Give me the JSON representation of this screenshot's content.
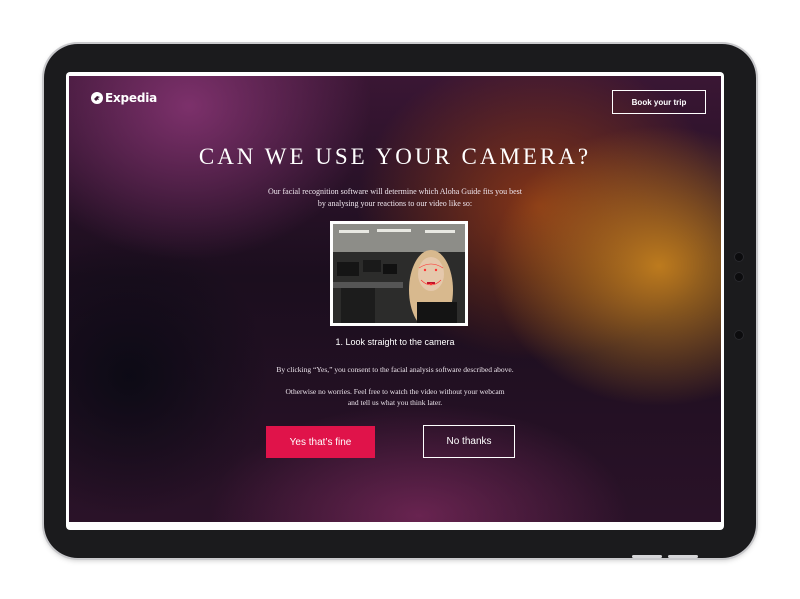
{
  "brand": {
    "name": "Expedia",
    "logo_icon": "plane-globe-icon"
  },
  "header": {
    "cta_label": "Book your trip"
  },
  "main": {
    "title": "CAN WE USE YOUR CAMERA?",
    "subtitle_line1": "Our facial recognition software will determine which Aloha Guide fits you best",
    "subtitle_line2": "by analysing your reactions to our video like so:",
    "step_caption": "1. Look straight to the camera",
    "consent_text": "By clicking “Yes,” you consent to the facial analysis software described above.",
    "otherwise_line1": "Otherwise no worries. Feel free to watch the video without your webcam",
    "otherwise_line2": "and tell us what you think later."
  },
  "actions": {
    "accept_label": "Yes that’s fine",
    "decline_label": "No thanks"
  },
  "colors": {
    "accent": "#e0134a",
    "text": "#ffffff",
    "device_frame": "#1b1b1d"
  }
}
